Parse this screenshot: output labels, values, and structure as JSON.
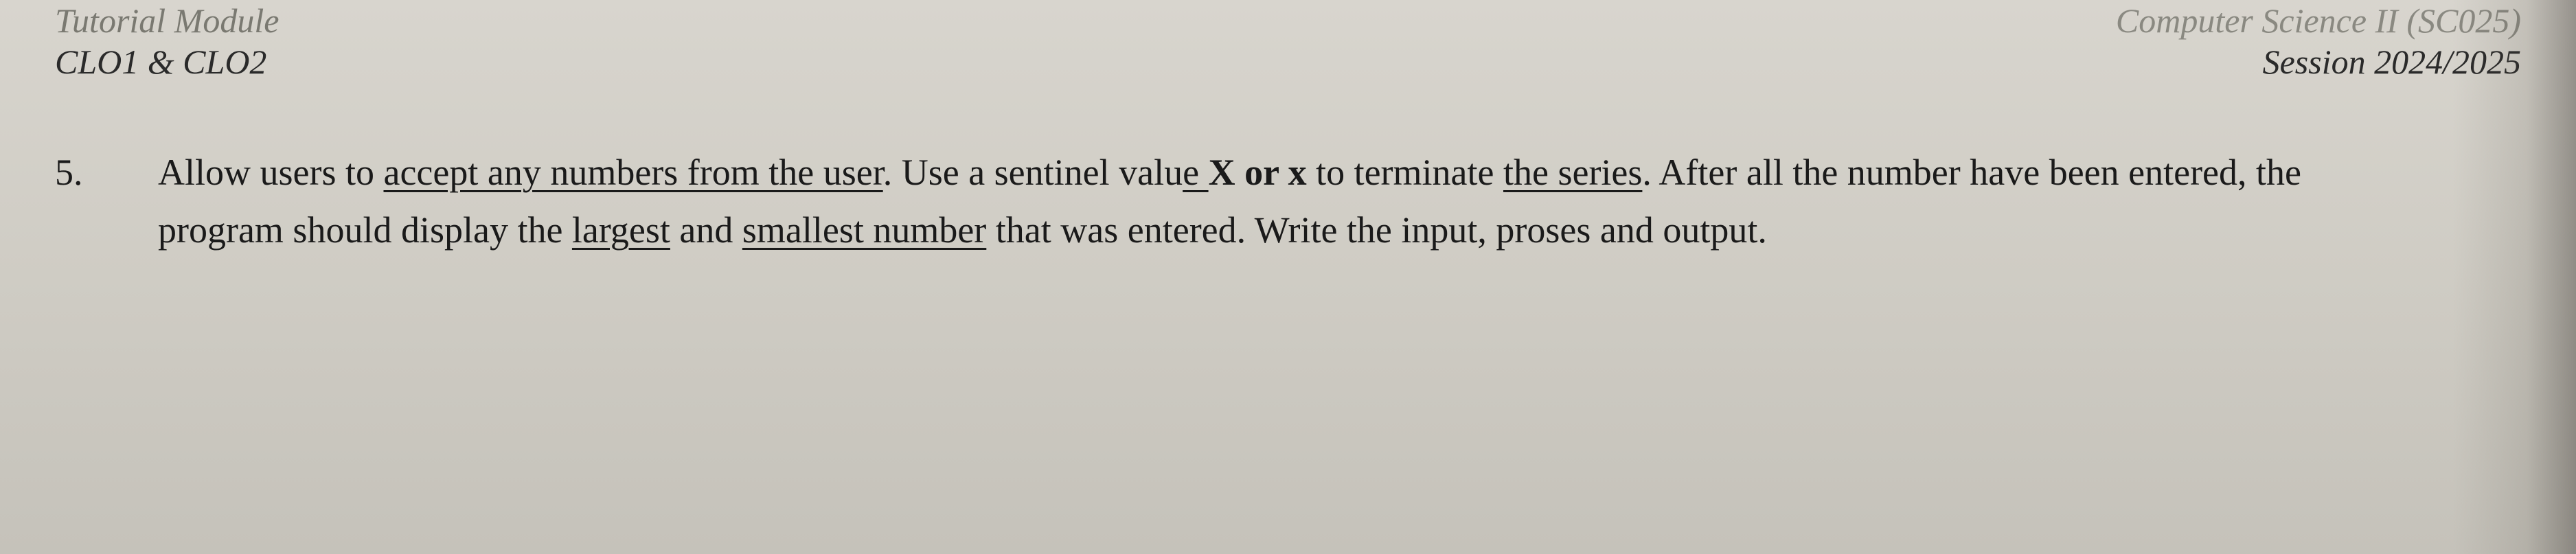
{
  "header": {
    "left_line1": "Tutorial Module",
    "left_line2": "CLO1 & CLO2",
    "right_line1": "Computer Science II (SC025)",
    "right_line2": "Session 2024/2025"
  },
  "question": {
    "number": "5.",
    "text_parts": {
      "p1": "Allow users to ",
      "p2_underlined": "accept any numbers from the user",
      "p3": ". Use a sentinel valu",
      "p4_underlined": "e ",
      "p5_bold": "X or x",
      "p6": " to terminate ",
      "p7_underlined": "the series",
      "p8": ". After all the number have been entered, the program should display the ",
      "p9_underlined": "largest",
      "p10": " and ",
      "p11_underlined": "smallest number",
      "p12": " that was entered. Write the input, proses and output."
    }
  }
}
